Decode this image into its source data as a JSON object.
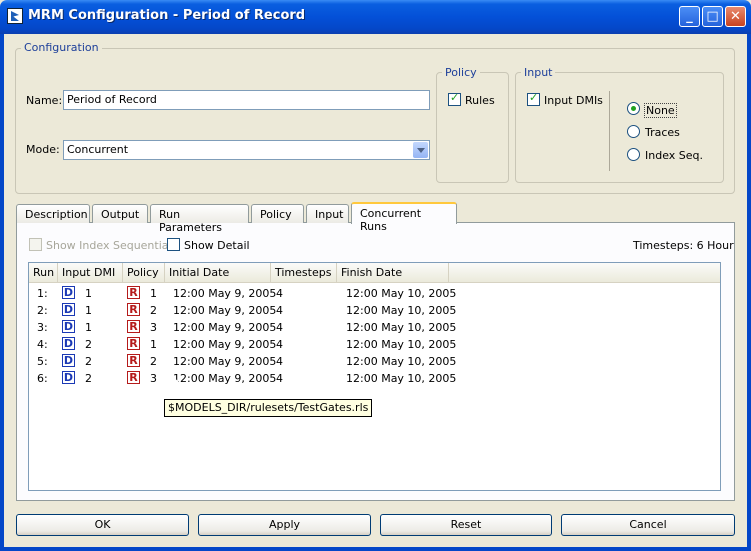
{
  "window": {
    "title": "MRM Configuration - Period of Record"
  },
  "configuration": {
    "group_title": "Configuration",
    "name_label": "Name:",
    "name_value": "Period of Record",
    "mode_label": "Mode:",
    "mode_value": "Concurrent"
  },
  "policy": {
    "group_title": "Policy",
    "rules_label": "Rules",
    "rules_checked": true
  },
  "input": {
    "group_title": "Input",
    "input_dmis_label": "Input DMIs",
    "input_dmis_checked": true,
    "radio_options": [
      "None",
      "Traces",
      "Index Seq."
    ],
    "selected": "None"
  },
  "tabs": [
    "Description",
    "Output",
    "Run Parameters",
    "Policy",
    "Input",
    "Concurrent Runs"
  ],
  "active_tab": "Concurrent Runs",
  "concurrent_runs": {
    "show_index_sequential_label": "Show Index Sequential",
    "show_detail_label": "Show Detail",
    "timesteps_label": "Timesteps: 6 Hour",
    "columns": [
      "Run",
      "Input DMI",
      "Policy",
      "Initial Date",
      "Timesteps",
      "Finish Date"
    ],
    "dmi_badge": "D",
    "policy_badge": "R",
    "rows": [
      {
        "run": "1:",
        "input_dmi": "1",
        "policy": "1",
        "initial_date": "12:00 May 9, 2005",
        "timesteps": "4",
        "finish_date": "12:00 May 10, 2005"
      },
      {
        "run": "2:",
        "input_dmi": "1",
        "policy": "2",
        "initial_date": "12:00 May 9, 2005",
        "timesteps": "4",
        "finish_date": "12:00 May 10, 2005"
      },
      {
        "run": "3:",
        "input_dmi": "1",
        "policy": "3",
        "initial_date": "12:00 May 9, 2005",
        "timesteps": "4",
        "finish_date": "12:00 May 10, 2005"
      },
      {
        "run": "4:",
        "input_dmi": "2",
        "policy": "1",
        "initial_date": "12:00 May 9, 2005",
        "timesteps": "4",
        "finish_date": "12:00 May 10, 2005"
      },
      {
        "run": "5:",
        "input_dmi": "2",
        "policy": "2",
        "initial_date": "12:00 May 9, 2005",
        "timesteps": "4",
        "finish_date": "12:00 May 10, 2005"
      },
      {
        "run": "6:",
        "input_dmi": "2",
        "policy": "3",
        "initial_date": "12:00 May 9, 2005",
        "timesteps": "4",
        "finish_date": "12:00 May 10, 2005"
      }
    ],
    "tooltip": "$MODELS_DIR/rulesets/TestGates.rls"
  },
  "buttons": {
    "ok": "OK",
    "apply": "Apply",
    "reset": "Reset",
    "cancel": "Cancel"
  }
}
